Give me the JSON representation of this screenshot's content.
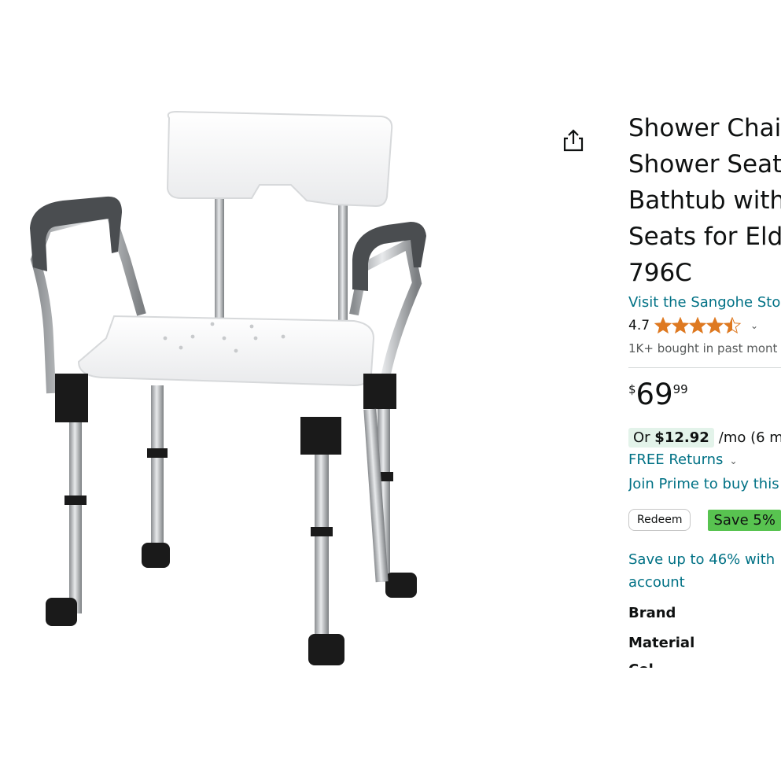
{
  "product": {
    "title_lines": [
      "Shower Chai",
      "Shower Seat",
      "Bathtub with",
      "Seats for Eld",
      "796C"
    ],
    "image_alt": "shower-chair-with-arms-and-back"
  },
  "store": {
    "link": "Visit the Sangohe Sto"
  },
  "rating": {
    "value": "4.7",
    "stars": 4.5,
    "star_color": "#de7921"
  },
  "social": {
    "bought": "1K+ bought in past mont"
  },
  "price": {
    "symbol": "$",
    "whole": "69",
    "fraction": "99"
  },
  "monthly": {
    "prefix": "Or ",
    "amount": "$12.92",
    "rest": "/mo (6 m"
  },
  "links": {
    "returns": "FREE Returns",
    "prime": "Join Prime to buy this"
  },
  "coupon": {
    "redeem": "Redeem",
    "save": "Save 5%"
  },
  "promo": {
    "save_up": "Save up to 46% with account"
  },
  "specs": {
    "brand": "Brand",
    "material": "Material",
    "cutoff": "Col"
  },
  "colors": {
    "link": "#007185",
    "save_badge": "#58c350",
    "monthly_bg": "#e3f3ea"
  }
}
